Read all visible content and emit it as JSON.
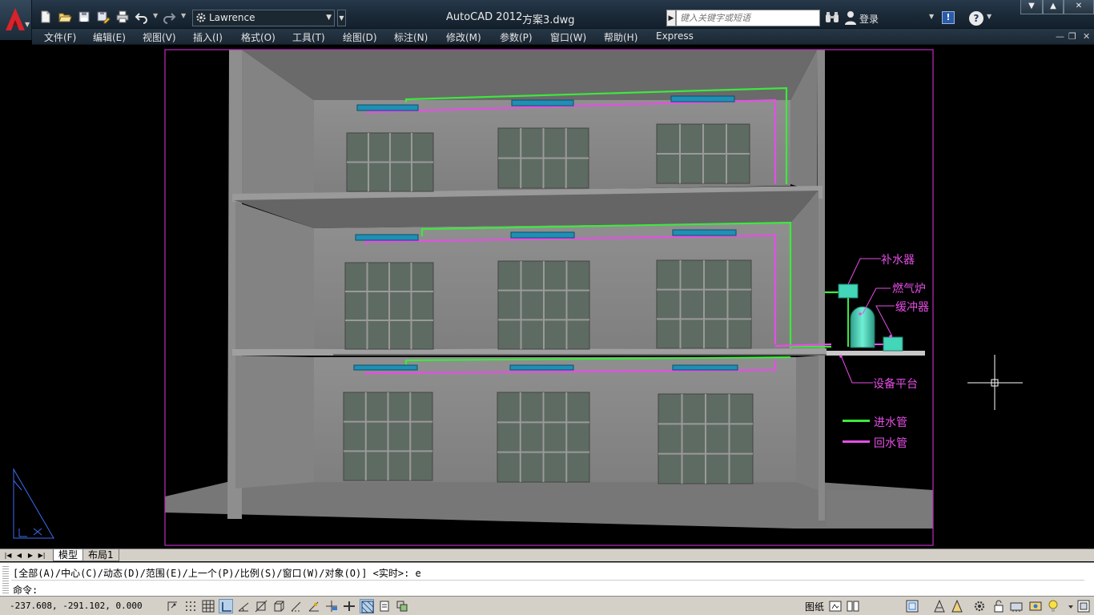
{
  "titlebar": {
    "workspace": "Lawrence",
    "app_name": "AutoCAD 2012",
    "document": "方案3.dwg",
    "search_placeholder": "键入关键字或短语",
    "login_label": "登录",
    "exchange_label": "!",
    "help_label": "?",
    "minimize": "▼",
    "maximize": "▲",
    "close": "✕"
  },
  "menu": {
    "items": [
      "文件(F)",
      "编辑(E)",
      "视图(V)",
      "插入(I)",
      "格式(O)",
      "工具(T)",
      "绘图(D)",
      "标注(N)",
      "修改(M)",
      "参数(P)",
      "窗口(W)",
      "帮助(H)",
      "Express"
    ],
    "doc_minimize": "—",
    "doc_restore": "❐",
    "doc_close": "✕"
  },
  "drawing": {
    "annotations": {
      "makeup_water": "补水器",
      "gas_boiler": "燃气炉",
      "buffer_tank": "缓冲器",
      "equipment_platform": "设备平台"
    },
    "legend": [
      {
        "label": "进水管",
        "color": "#3ee83e"
      },
      {
        "label": "回水管",
        "color": "#e64ee6"
      }
    ],
    "colors": {
      "viewport_border": "#c028c0",
      "wall": "#8c8c8c",
      "window": "#5e6b62",
      "radiator": "#1f8fb4",
      "boiler": "#43d6b8"
    }
  },
  "layout_tabs": {
    "model": "模型",
    "layout1": "布局1"
  },
  "command": {
    "history": "[全部(A)/中心(C)/动态(D)/范围(E)/上一个(P)/比例(S)/窗口(W)/对象(O)] <实时>: e",
    "prompt": "命令:"
  },
  "status": {
    "coordinates": "-237.608, -291.102, 0.000",
    "paper": "图纸"
  }
}
